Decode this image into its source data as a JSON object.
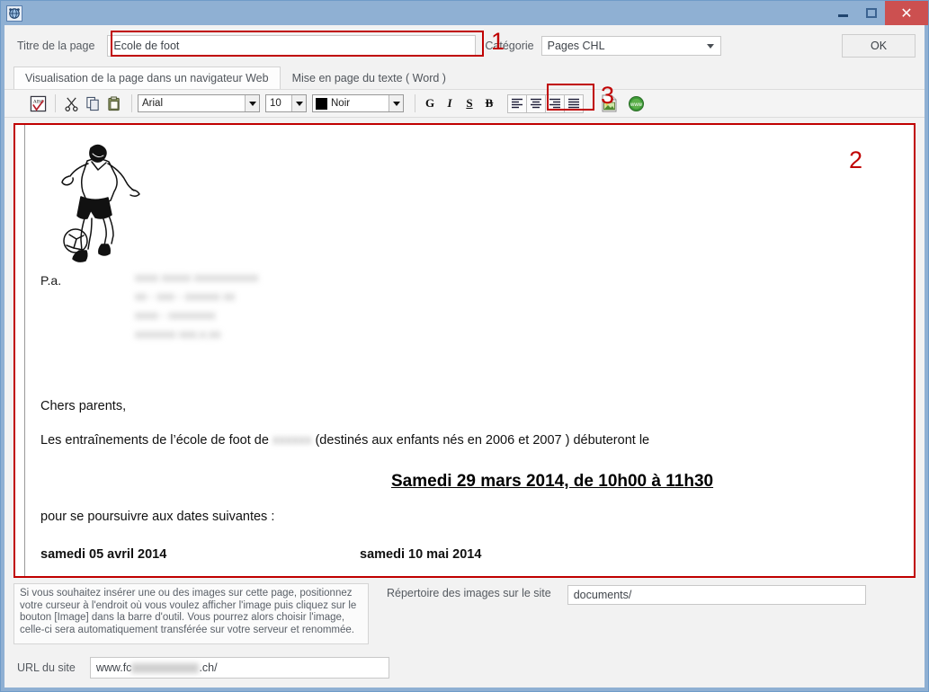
{
  "window": {
    "app_icon": "globe-network-icon",
    "title": "",
    "minimize_label": "",
    "maximize_label": "",
    "close_label": "✕"
  },
  "header": {
    "title_label": "Titre de la page",
    "title_value": "Ecole de foot",
    "category_label": "Catégorie",
    "category_value": "Pages CHL",
    "category_options": [
      "Pages CHL"
    ],
    "ok_label": "OK"
  },
  "annotations": [
    {
      "id": "1",
      "text": "1"
    },
    {
      "id": "2",
      "text": "2"
    },
    {
      "id": "3",
      "text": "3"
    }
  ],
  "tabs": [
    {
      "label": "Visualisation de la page dans un navigateur Web",
      "active": true
    },
    {
      "label": "Mise en page du texte ( Word )",
      "active": false
    }
  ],
  "toolbar": {
    "spellcheck_icon": "spellcheck-abc-icon",
    "cut_icon": "scissors-icon",
    "copy_icon": "copy-icon",
    "paste_icon": "paste-icon",
    "font_value": "Arial",
    "size_value": "10",
    "color_value": "Noir",
    "color_hex": "#000000",
    "bold_label": "G",
    "italic_label": "I",
    "underline_label": "S",
    "strike_label": "B",
    "align_left_icon": "align-left-icon",
    "align_center_icon": "align-center-icon",
    "align_right_icon": "align-right-icon",
    "align_justify_icon": "align-justify-icon",
    "insert_image_icon": "insert-image-icon",
    "insert_link_icon": "insert-web-link-icon"
  },
  "document": {
    "illustration": "soccer-player-line-art",
    "pa_label": "P.a.",
    "redacted_address": [
      "xxxx xxxxx xxxxxxxxxxx",
      "xx - xxx - xxxxxx xx",
      "xxxx - xxxxxxxx",
      "xxxxxxx xxx.x.xx"
    ],
    "greeting": "Chers parents,",
    "paragraph_1_before": "Les entraînements de l’école de foot de ",
    "paragraph_1_redacted": "xxxxxx",
    "paragraph_1_after": " (destinés aux enfants nés en 2006 et 2007 ) débuteront le",
    "headline_date": "Samedi 29 mars 2014, de 10h00 à 11h30 ",
    "paragraph_2": "pour se poursuivre aux dates suivantes :",
    "date_1": "samedi 05 avril  2014",
    "date_2": "samedi  10  mai  2014"
  },
  "bottom": {
    "help_text": "Si vous souhaitez insérer une ou des images sur cette page, positionnez votre curseur à l'endroit où vous voulez afficher l'image puis cliquez sur le bouton [Image] dans la barre d'outil. Vous pourrez alors choisir l'image, celle-ci sera automatiquement transférée sur votre serveur et renommée.",
    "repertoire_label": "Répertoire des images sur le site",
    "repertoire_value": "documents/",
    "url_label": "URL du site",
    "url_prefix": "www.fc",
    "url_suffix": ".ch/"
  },
  "colors": {
    "titlebar": "#8fb0d3",
    "annotation_red": "#c00000",
    "close_button": "#cc5050",
    "panel_bg": "#f2f2f2"
  }
}
